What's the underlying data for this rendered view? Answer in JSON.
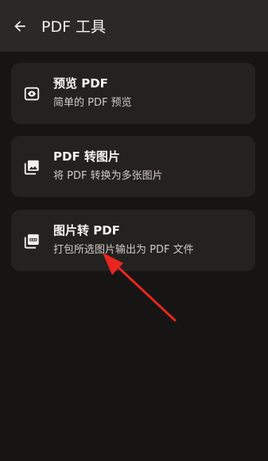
{
  "app_bar": {
    "title": "PDF 工具",
    "back_icon": "arrow-back-icon"
  },
  "tools": [
    {
      "id": "preview",
      "icon": "eye-icon",
      "title": "预览 PDF",
      "subtitle": "简单的 PDF 预览"
    },
    {
      "id": "pdf-to-images",
      "icon": "image-icon",
      "title": "PDF 转图片",
      "subtitle": "将 PDF 转换为多张图片"
    },
    {
      "id": "images-to-pdf",
      "icon": "pdf-file-icon",
      "title": "图片转 PDF",
      "subtitle": "打包所选图片输出为 PDF 文件"
    }
  ],
  "colors": {
    "background": "#161514",
    "app_bar": "#2b2826",
    "card": "#242220",
    "annotation_arrow": "#e8251f"
  }
}
